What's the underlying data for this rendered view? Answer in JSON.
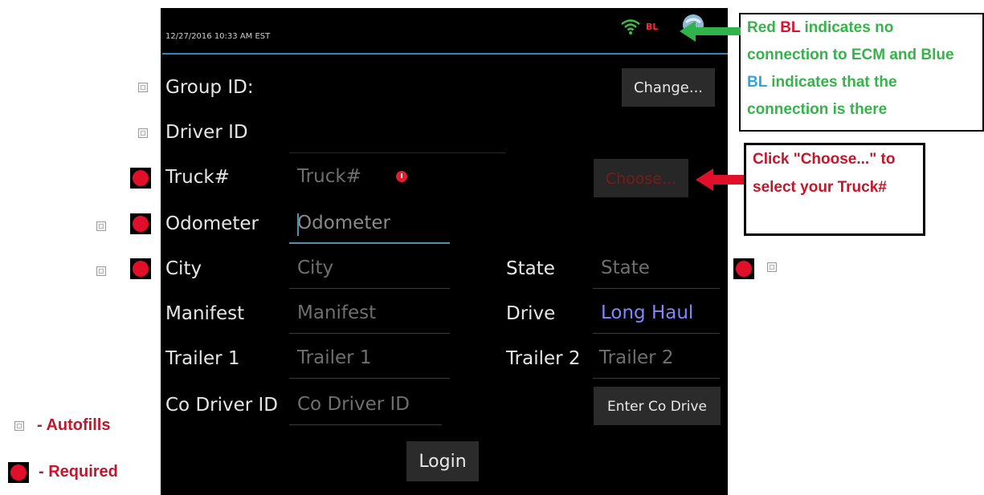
{
  "status_bar": {
    "datetime": "12/27/2016 10:33 AM EST",
    "bl_indicator": "BL",
    "icons": [
      "wifi-icon",
      "globe-icon"
    ]
  },
  "form": {
    "group_id_label": "Group ID:",
    "change_button": "Change...",
    "driver_id_label": "Driver ID",
    "truck_label": "Truck#",
    "truck_placeholder": "Truck#",
    "choose_button": "Choose...",
    "odometer_label": "Odometer",
    "odometer_placeholder": "Odometer",
    "city_label": "City",
    "city_placeholder": "City",
    "state_label": "State",
    "state_placeholder": "State",
    "manifest_label": "Manifest",
    "manifest_placeholder": "Manifest",
    "drive_label": "Drive",
    "drive_value": "Long Haul",
    "trailer1_label": "Trailer 1",
    "trailer1_placeholder": "Trailer 1",
    "trailer2_label": "Trailer 2",
    "trailer2_placeholder": "Trailer 2",
    "codriver_label": "Co Driver ID",
    "codriver_placeholder": "Co Driver ID",
    "enter_codriver_button": "Enter Co Drive",
    "login_button": "Login"
  },
  "annotations": {
    "bl_note": {
      "part1": "Red ",
      "part2": "BL",
      "part3": " indicates no connection to ECM and Blue ",
      "part4": "BL",
      "part5": " indicates that the connection is there"
    },
    "choose_note": "Click \"Choose...\" to select your Truck#",
    "legend_autofills": "- Autofills",
    "legend_required": "- Required"
  },
  "colors": {
    "screen_bg": "#000000",
    "accent_line": "#2f86b8",
    "required_red": "#e0102a",
    "note_green": "#36b34a",
    "long_haul_blue": "#8088ff"
  }
}
